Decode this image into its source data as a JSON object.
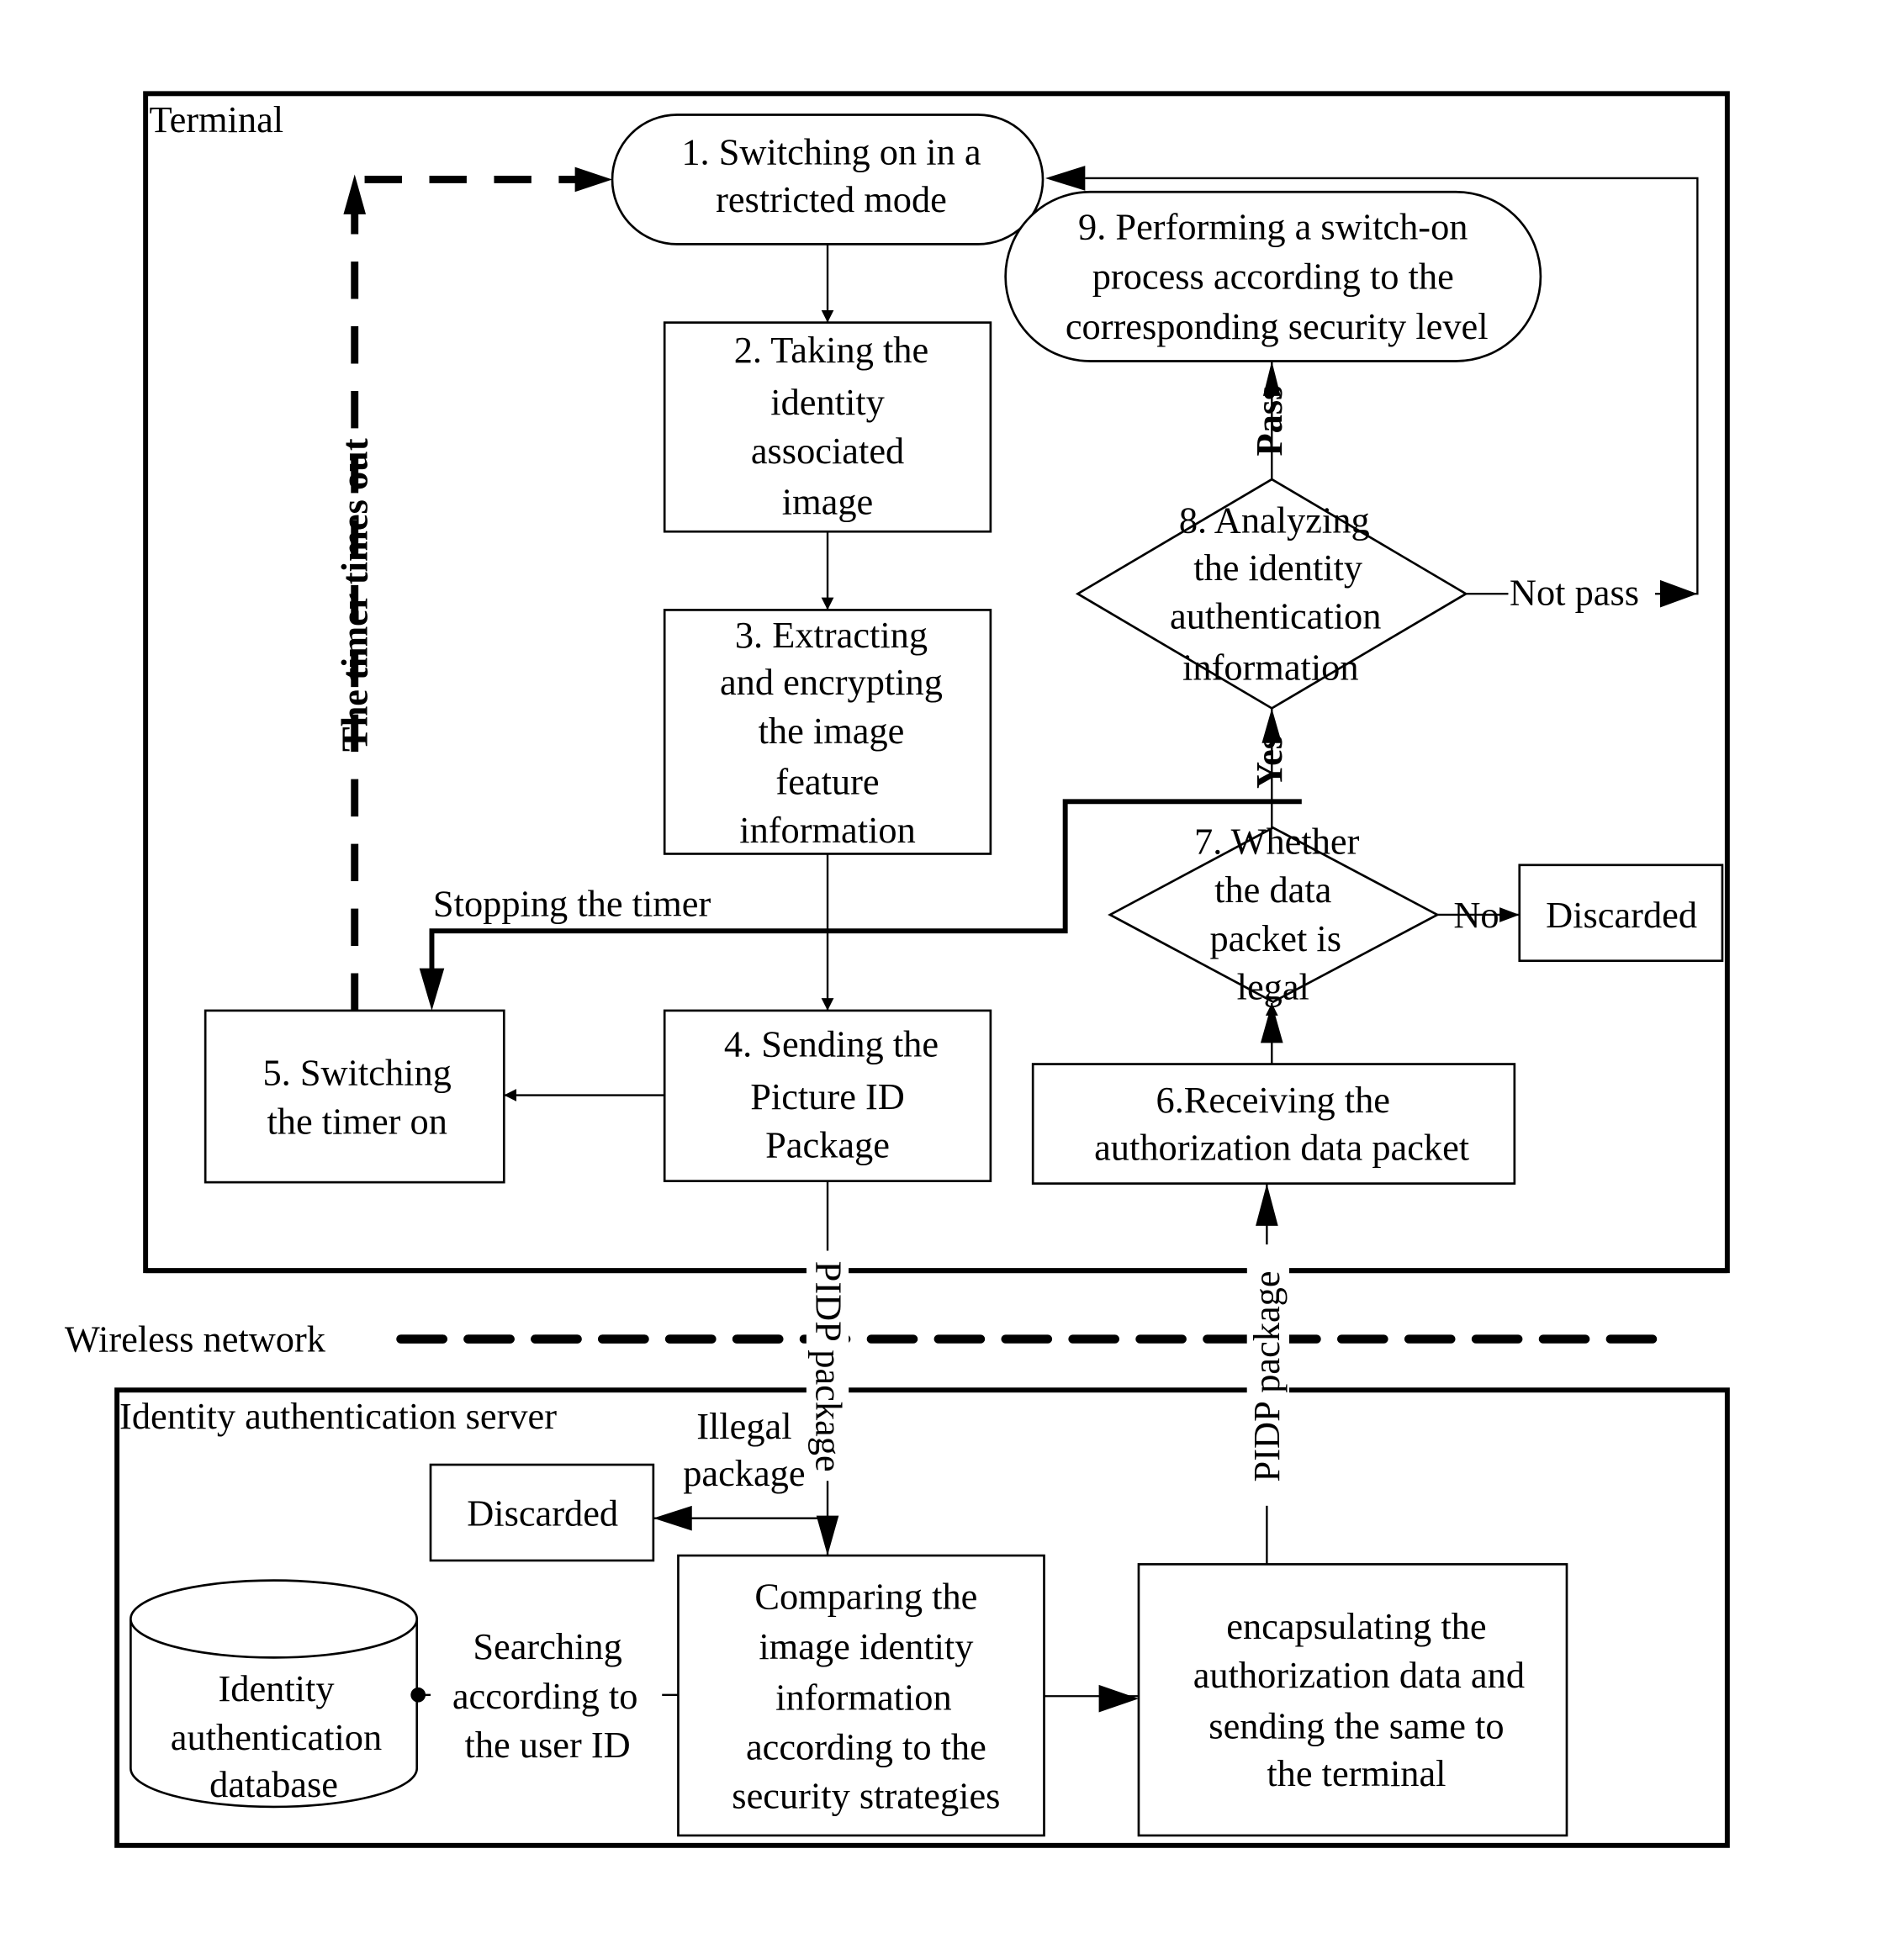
{
  "regions": {
    "terminal": "Terminal",
    "wireless": "Wireless network",
    "server": "Identity authentication server"
  },
  "nodes": {
    "n1": [
      "1. Switching on in a",
      "restricted mode"
    ],
    "n2": [
      "2. Taking the",
      "identity",
      "associated",
      "image"
    ],
    "n3": [
      "3. Extracting",
      "and encrypting",
      "the image",
      "feature",
      "information"
    ],
    "n4": [
      "4. Sending the",
      "Picture ID",
      "Package"
    ],
    "n5": [
      "5. Switching",
      "the timer on"
    ],
    "n6": [
      "6.Receiving the",
      "authorization data packet"
    ],
    "n7": [
      "7. Whether",
      "the data",
      "packet is",
      "legal"
    ],
    "n8": [
      "8. Analyzing",
      "the identity",
      "authentication",
      "information"
    ],
    "n9": [
      "9. Performing a switch-on",
      "process according to the",
      "corresponding security level"
    ],
    "discarded_terminal": "Discarded",
    "discarded_server": "Discarded",
    "database": [
      "Identity",
      "authentication",
      "database"
    ],
    "compare": [
      "Comparing the",
      "image identity",
      "information",
      "according to the",
      "security strategies"
    ],
    "encapsulate": [
      "encapsulating the",
      "authorization data and",
      "sending the same to",
      "the terminal"
    ]
  },
  "edges": {
    "timer_timeout": "The timer times out",
    "stop_timer": "Stopping the timer",
    "pass": "Pass",
    "not_pass": "Not pass",
    "yes": "Yes",
    "no": "No",
    "pidp_down": "PIDP package",
    "pidp_up": "PIDP package",
    "illegal": [
      "Illegal",
      "package"
    ],
    "searching": [
      "Searching",
      "according to",
      "the user ID"
    ]
  }
}
